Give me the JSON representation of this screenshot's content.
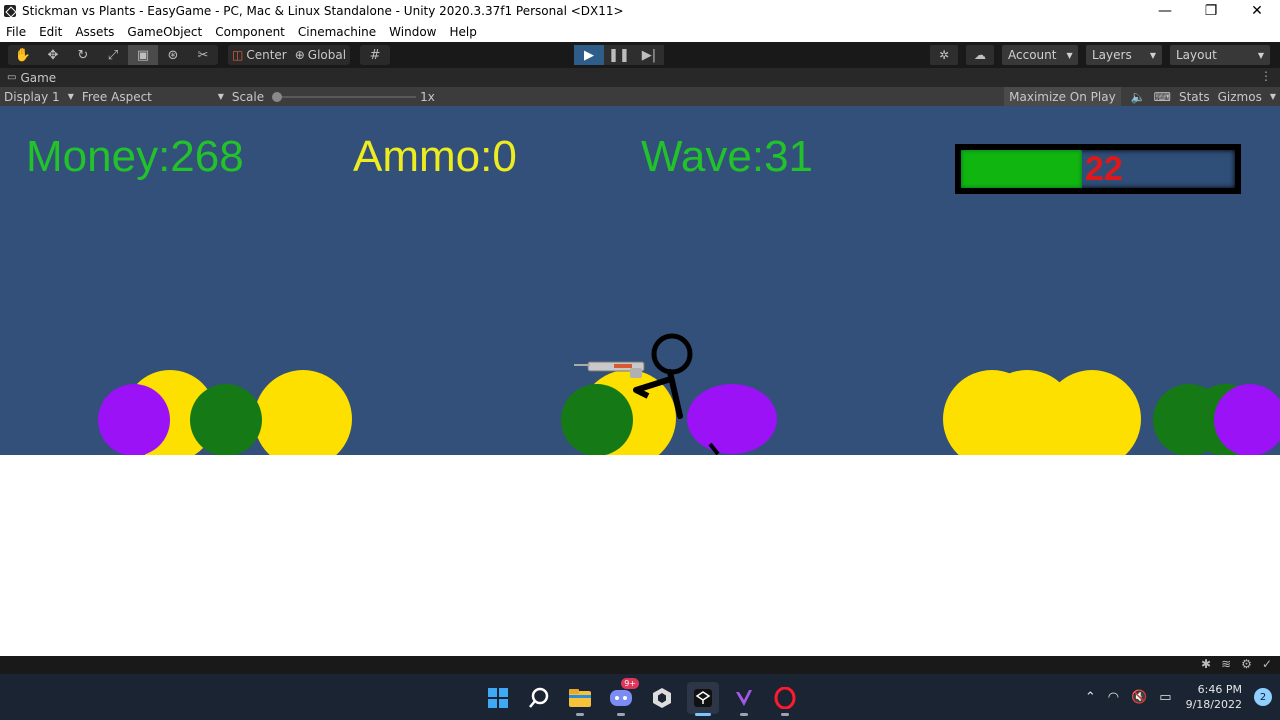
{
  "window": {
    "title": "Stickman vs Plants - EasyGame - PC, Mac & Linux Standalone - Unity 2020.3.37f1 Personal <DX11>",
    "controls": [
      "minimize",
      "maximize",
      "close"
    ]
  },
  "menu": [
    "File",
    "Edit",
    "Assets",
    "GameObject",
    "Component",
    "Cinemachine",
    "Window",
    "Help"
  ],
  "toolbar": {
    "tools": [
      "hand-tool",
      "move-tool",
      "rotate-tool",
      "scale-tool",
      "rect-tool",
      "transform-tool",
      "custom-tool"
    ],
    "pivot_label": "Center",
    "space_label": "Global",
    "account_label": "Account",
    "layers_label": "Layers",
    "layout_label": "Layout"
  },
  "game_tab": {
    "label": "Game"
  },
  "game_bar": {
    "display_label": "Display 1",
    "aspect_label": "Free Aspect",
    "scale_label": "Scale",
    "scale_value": "1x",
    "maximize_label": "Maximize On Play",
    "stats_label": "Stats",
    "gizmos_label": "Gizmos"
  },
  "hud": {
    "money": "Money:268",
    "ammo": "Ammo:0",
    "wave": "Wave:31",
    "health_value": "22",
    "health_fraction": 0.44
  },
  "colors": {
    "sky": "#32507a",
    "money": "#22c22a",
    "ammo": "#ecec1f",
    "health_fill": "#11b50f",
    "health_text": "#e01818",
    "plant_yellow": "#fde000",
    "plant_green": "#157a15",
    "plant_purple": "#9a12f5"
  },
  "taskbar": {
    "apps": [
      "windows-start",
      "search",
      "file-explorer",
      "discord",
      "unity-hub",
      "unity-editor",
      "visual-studio",
      "opera"
    ],
    "discord_badge": "9+",
    "time": "6:46 PM",
    "date": "9/18/2022",
    "notifications": "2"
  }
}
